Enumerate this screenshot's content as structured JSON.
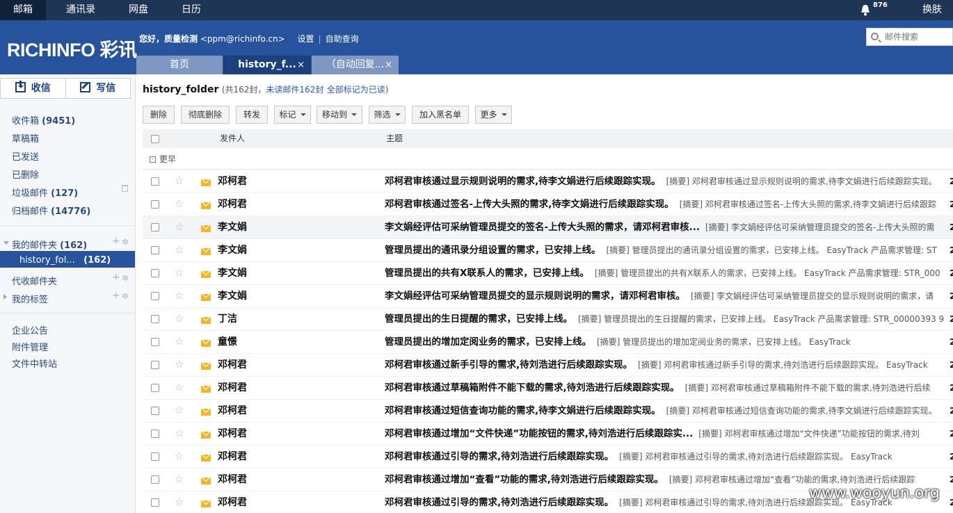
{
  "topnav": {
    "tabs": [
      "邮箱",
      "通讯录",
      "网盘",
      "日历"
    ],
    "badge": "876",
    "skin": "换肤"
  },
  "header": {
    "logo": "RICHINFO 彩讯",
    "greeting_prefix": "您好，",
    "user_name": "质量检测",
    "email": "<ppm@richinfo.cn>",
    "settings": "设置",
    "auto_query": "自助查询",
    "search_placeholder": "邮件搜索",
    "tabs": {
      "home": "首页",
      "current": "history_f...",
      "auto": "（自动回复..."
    },
    "close": "×"
  },
  "sidebar": {
    "receive": "收信",
    "write": "写信",
    "inbox": "收件箱",
    "inbox_count": "(9451)",
    "drafts": "草稿箱",
    "sent": "已发送",
    "deleted": "已删除",
    "spam": "垃圾邮件",
    "spam_count": "(127)",
    "archive": "归档邮件",
    "archive_count": "(14776)",
    "my_folders": "我的邮件夹",
    "my_folders_count": "(162)",
    "history_folder": "history_fol...",
    "history_count": "(162)",
    "proxy": "代收邮件夹",
    "tags": "我的标签",
    "announce": "企业公告",
    "attachments": "附件管理",
    "transfer": "文件中转站"
  },
  "main": {
    "folder_name": "history_folder",
    "count_text": "(共162封，",
    "unread_text": "未读邮件162封",
    "mark_all": "全部标记为已读",
    "close_paren": ")",
    "toolbar": {
      "delete": "删除",
      "perm_delete": "彻底删除",
      "forward": "转发",
      "mark": "标记",
      "move": "移动到",
      "filter": "筛选",
      "blacklist": "加入黑名单",
      "more": "更多"
    },
    "header_sender": "发件人",
    "header_subject": "主题",
    "group": "更早",
    "rows": [
      {
        "sender": "邓柯君",
        "subject": "邓柯君审核通过显示规则说明的需求,待李文娟进行后续跟踪实现。",
        "summary": "[摘要] 邓柯君审核通过显示规则说明的需求,待李文娟进行后续跟踪实现。",
        "date": "2"
      },
      {
        "sender": "邓柯君",
        "subject": "邓柯君审核通过签名-上传大头照的需求,待李文娟进行后续跟踪实现。",
        "summary": "[摘要] 邓柯君审核通过签名-上传大头照的需求,待李文娟进行后续跟踪",
        "date": "2"
      },
      {
        "sender": "李文娟",
        "subject": "李文娟经评估可采纳管理员提交的签名-上传大头照的需求，请邓柯君审核...",
        "summary": "[摘要] 李文娟经评估可采纳管理员提交的签名-上传大头照的需",
        "date": "2"
      },
      {
        "sender": "李文娟",
        "subject": "管理员提出的通讯录分组设置的需求，已安排上线。",
        "summary": "[摘要] 管理员提出的通讯录分组设置的需求，已安排上线。 EasyTrack 产品需求管理: ST",
        "date": "2"
      },
      {
        "sender": "李文娟",
        "subject": "管理员提出的共有X联系人的需求，已安排上线。",
        "summary": "[摘要] 管理员提出的共有X联系人的需求，已安排上线。 EasyTrack 产品需求管理: STR_000",
        "date": "2"
      },
      {
        "sender": "李文娟",
        "subject": "李文娟经评估可采纳管理员提交的显示规则说明的需求，请邓柯君审核。",
        "summary": "[摘要] 李文娟经评估可采纳管理员提交的显示规则说明的需求，请",
        "date": "2"
      },
      {
        "sender": "丁洁",
        "subject": "管理员提出的生日提醒的需求，已安排上线。",
        "summary": "[摘要] 管理员提出的生日提醒的需求，已安排上线。 EasyTrack 产品需求管理: STR_00000393 9",
        "date": "2"
      },
      {
        "sender": "童憬",
        "subject": "管理员提出的增加定阅业务的需求，已安排上线。",
        "summary": "[摘要] 管理员提出的增加定阅业务的需求，已安排上线。 EasyTrack",
        "date": "2"
      },
      {
        "sender": "邓柯君",
        "subject": "邓柯君审核通过新手引导的需求,待刘浩进行后续跟踪实现。",
        "summary": "[摘要] 邓柯君审核通过新手引导的需求,待刘浩进行后续跟踪实现。 EasyTrack",
        "date": "2"
      },
      {
        "sender": "邓柯君",
        "subject": "邓柯君审核通过草稿箱附件不能下载的需求,待刘浩进行后续跟踪实现。",
        "summary": "[摘要] 邓柯君审核通过草稿箱附件不能下载的需求,待刘浩进行后续",
        "date": "2"
      },
      {
        "sender": "邓柯君",
        "subject": "邓柯君审核通过短信查询功能的需求,待李文娟进行后续跟踪实现。",
        "summary": "[摘要] 邓柯君审核通过短信查询功能的需求,待李文娟进行后续跟踪实现。",
        "date": "2"
      },
      {
        "sender": "邓柯君",
        "subject": "邓柯君审核通过增加“文件快递”功能按钮的需求,待刘浩进行后续跟踪实...",
        "summary": "[摘要] 邓柯君审核通过增加“文件快递”功能按钮的需求,待刘",
        "date": "2"
      },
      {
        "sender": "邓柯君",
        "subject": "邓柯君审核通过引导的需求,待刘浩进行后续跟踪实现。",
        "summary": "[摘要] 邓柯君审核通过引导的需求,待刘浩进行后续跟踪实现。 EasyTrack",
        "date": "2"
      },
      {
        "sender": "邓柯君",
        "subject": "邓柯君审核通过增加“查看”功能的需求,待刘浩进行后续跟踪实现。",
        "summary": "[摘要] 邓柯君审核通过增加“查看”功能的需求,待刘浩进行后续跟踪",
        "date": "2"
      },
      {
        "sender": "邓柯君",
        "subject": "邓柯君审核通过引导的需求,待刘浩进行后续跟踪实现。",
        "summary": "[摘要] 邓柯君审核通过引导的需求,待刘浩进行后续跟踪实现。 EasyTrack",
        "date": "2"
      }
    ]
  },
  "watermark": "www.wooyun.org",
  "colors": {
    "topbar": "#1f3555",
    "header": "#27539d",
    "accent": "#27539d",
    "envelope": "#f0b72b"
  }
}
